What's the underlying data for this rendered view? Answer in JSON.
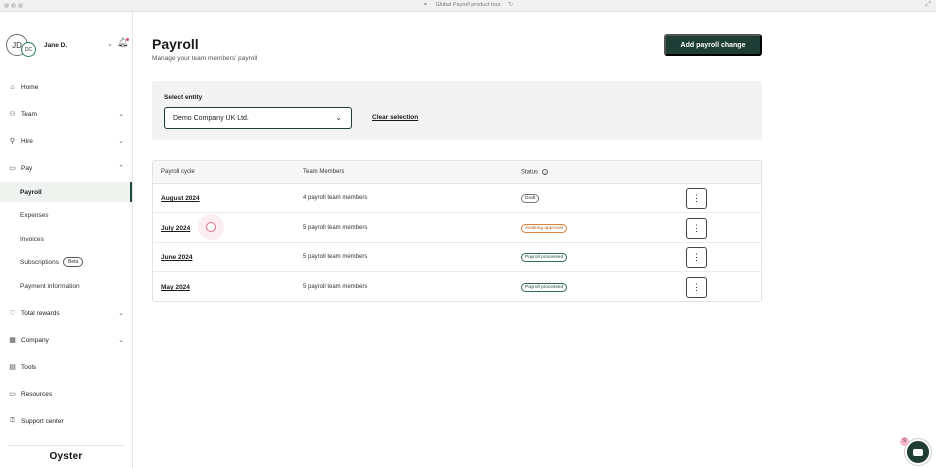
{
  "window": {
    "title": "Global Payroll product tour"
  },
  "user": {
    "initials_primary": "JD",
    "initials_secondary": "DC",
    "name": "Jane D."
  },
  "nav": {
    "home": "Home",
    "team": "Team",
    "hire": "Hire",
    "pay": "Pay",
    "pay_sub": [
      "Payroll",
      "Expenses",
      "Invoices",
      "Subscriptions",
      "Payment information"
    ],
    "beta": "Beta",
    "total_rewards": "Total rewards",
    "company": "Company",
    "tools": "Tools",
    "resources": "Resources",
    "support": "Support center"
  },
  "brand": {
    "logo_text": "Oyster"
  },
  "header": {
    "title": "Payroll",
    "subtitle": "Manage your team members' payroll",
    "primary_button": "Add payroll change"
  },
  "entity": {
    "label": "Select entity",
    "selected": "Demo Company UK Ltd.",
    "clear_label": "Clear selection"
  },
  "table": {
    "columns": [
      "Payroll cycle",
      "Team Members",
      "Status"
    ],
    "rows": [
      {
        "cycle": "August 2024",
        "members": "4 payroll team members",
        "status": "Draft",
        "status_type": "draft"
      },
      {
        "cycle": "July 2024",
        "members": "5 payroll team members",
        "status": "Awaiting approval",
        "status_type": "awaiting"
      },
      {
        "cycle": "June 2024",
        "members": "5 payroll team members",
        "status": "Payroll processed",
        "status_type": "processed"
      },
      {
        "cycle": "May 2024",
        "members": "5 payroll team members",
        "status": "Payroll processed",
        "status_type": "processed"
      }
    ]
  },
  "chat": {
    "badge_count": "9"
  },
  "colors": {
    "primary": "#1e3d34",
    "awaiting": "#d9823b",
    "processed": "#2f6b52",
    "pink_accent": "#e0457b"
  },
  "icons": {
    "home": "home-icon",
    "team": "team-icon",
    "hire": "hire-icon",
    "pay": "pay-icon",
    "total_rewards": "heart-icon",
    "company": "building-icon",
    "tools": "tools-icon",
    "resources": "folder-icon",
    "support": "help-icon",
    "bell": "bell-icon",
    "chat": "chat-icon"
  }
}
